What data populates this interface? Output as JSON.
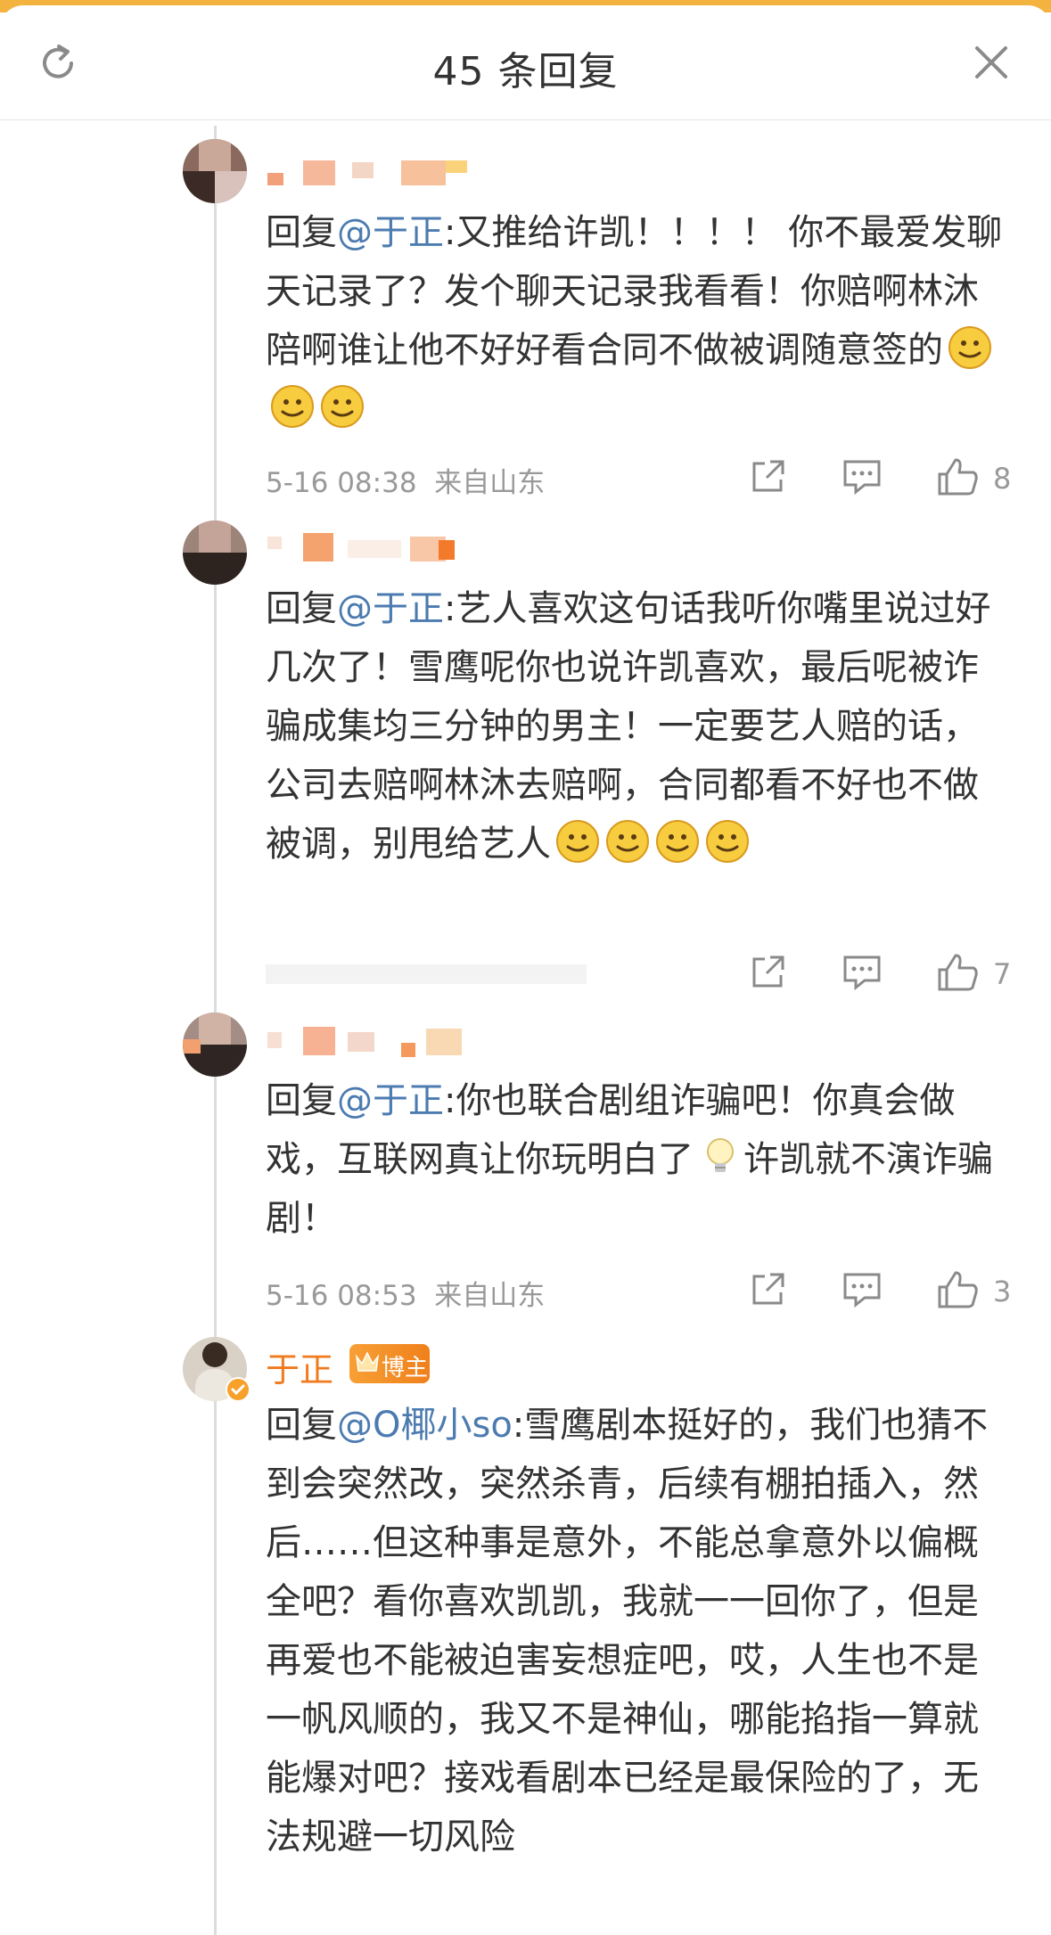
{
  "header": {
    "title": "45 条回复",
    "refresh_icon": "refresh-icon",
    "close_icon": "close-icon"
  },
  "comments": [
    {
      "reply_prefix": "回复",
      "mention": "@于正",
      "body": ":又推给许凯！！！！ 你不最爱发聊天记录了？发个聊天记录我看看！你赔啊林沐陪啊谁让他不好好看合同不做被调随意签的",
      "emoji_count": 3,
      "date": "5-16 08:38",
      "source": "来自山东",
      "likes": "8"
    },
    {
      "reply_prefix": "回复",
      "mention": "@于正",
      "body": ":艺人喜欢这句话我听你嘴里说过好几次了！雪鹰呢你也说许凯喜欢，最后呢被诈骗成集均三分钟的男主！一定要艺人赔的话，公司去赔啊林沐去赔啊，合同都看不好也不做被调，别甩给艺人",
      "emoji_count": 4,
      "date": "",
      "source": "",
      "likes": "7"
    },
    {
      "reply_prefix": "回复",
      "mention": "@于正",
      "body_part1": ":你也联合剧组诈骗吧！你真会做戏，互联网真让你玩明白了",
      "body_part2": "许凯就不演诈骗剧！",
      "date": "5-16 08:53",
      "source": "来自山东",
      "likes": "3"
    },
    {
      "author": "于正",
      "badge": "博主",
      "reply_prefix": "回复",
      "mention": "@O椰小so",
      "body": ":雪鹰剧本挺好的，我们也猜不到会突然改，突然杀青，后续有棚拍插入，然后……但这种事是意外，不能总拿意外以偏概全吧？看你喜欢凯凯，我就一一回你了，但是再爱也不能被迫害妄想症吧，哎，人生也不是一帆风顺的，我又不是神仙，哪能掐指一算就能爆对吧？接戏看剧本已经是最保险的了，无法规避一切风险"
    }
  ],
  "colors": {
    "mention": "#4c7bb0",
    "blogger_name": "#f07a1c",
    "meta": "#999999",
    "text": "#333333"
  }
}
